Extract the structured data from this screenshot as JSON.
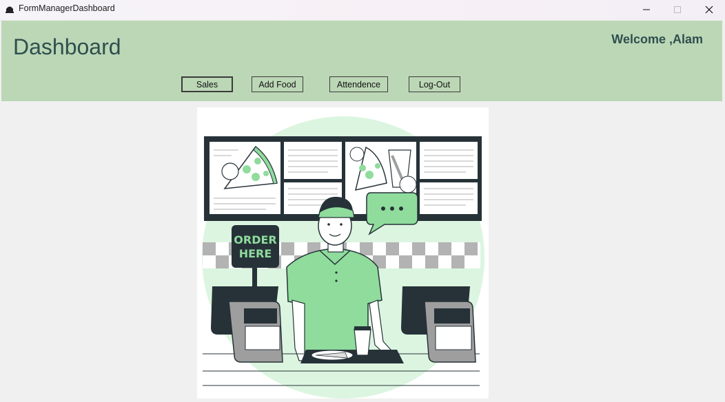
{
  "window": {
    "title": "FormManagerDashboard"
  },
  "header": {
    "title": "Dashboard",
    "welcome": "Welcome ,Alam"
  },
  "nav": {
    "sales": "Sales",
    "add_food": "Add Food",
    "attendence": "Attendence",
    "logout": "Log-Out"
  },
  "illustration": {
    "sign_line1": "ORDER",
    "sign_line2": "HERE"
  },
  "colors": {
    "header_bg": "#bcd7b6",
    "accent_green": "#8fdc9c",
    "dark": "#263238"
  }
}
